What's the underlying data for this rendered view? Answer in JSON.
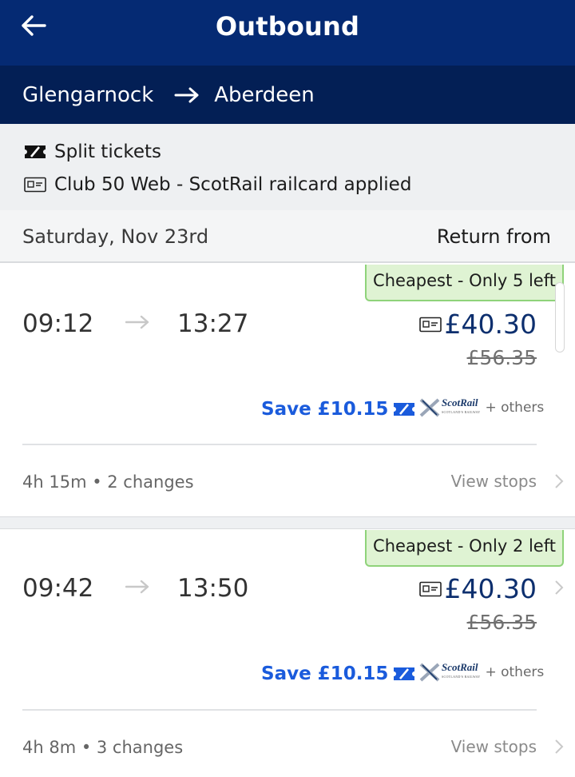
{
  "header": {
    "title": "Outbound",
    "back_icon": "back-arrow-icon"
  },
  "route": {
    "from": "Glengarnock",
    "to": "Aberdeen",
    "arrow_icon": "right-arrow-icon"
  },
  "info": {
    "split_label": "Split tickets",
    "split_icon": "split-ticket-icon",
    "railcard_label": "Club 50 Web - ScotRail railcard applied",
    "railcard_icon": "railcard-icon"
  },
  "date_bar": {
    "date": "Saturday, Nov 23rd",
    "return_label": "Return from"
  },
  "journeys": [
    {
      "badge": "Cheapest - Only 5 left",
      "depart": "09:12",
      "arrive": "13:27",
      "price": "£40.30",
      "old_price": "£56.35",
      "save": "Save £10.15",
      "operator_logo": "ScotRail",
      "operator_logo_sub": "SCOTLAND'S RAILWAY",
      "operator_extra": "+ others",
      "summary": "4h 15m • 2 changes",
      "view_stops": "View stops"
    },
    {
      "badge": "Cheapest - Only 2 left",
      "depart": "09:42",
      "arrive": "13:50",
      "price": "£40.30",
      "old_price": "£56.35",
      "save": "Save £10.15",
      "operator_logo": "ScotRail",
      "operator_logo_sub": "SCOTLAND'S RAILWAY",
      "operator_extra": "+ others",
      "summary": "4h 8m • 3 changes",
      "view_stops": "View stops"
    }
  ],
  "colors": {
    "header_bg": "#052a73",
    "route_bg": "#031f55",
    "price_text": "#0d2f6e",
    "save_text": "#1a5bdc",
    "badge_bg": "#dff3d3",
    "badge_border": "#8fd37a"
  }
}
